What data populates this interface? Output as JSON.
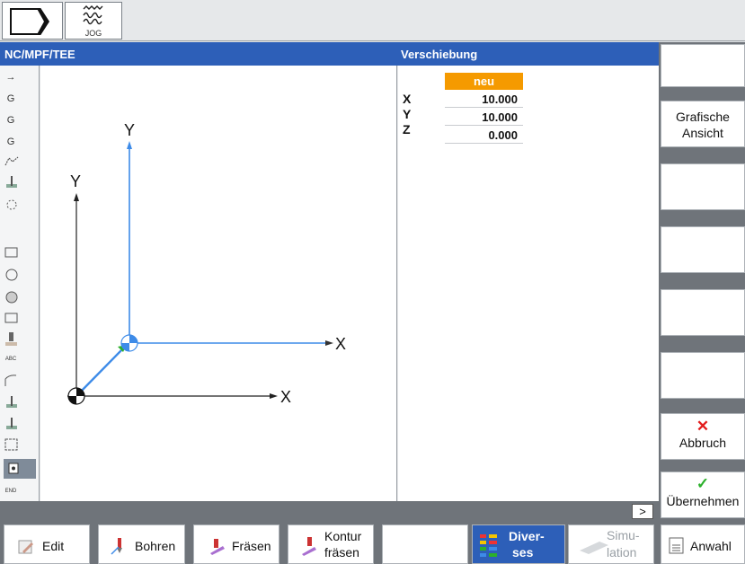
{
  "header": {
    "mode_icon": "block-arrow-icon",
    "jog_label": "JOG"
  },
  "titlebar": {
    "program_path": "NC/MPF/TEE",
    "dialog_title": "Verschiebung"
  },
  "left_strip": {
    "items": [
      "→",
      "G",
      "G",
      "G",
      "ABC",
      "END"
    ]
  },
  "graphic": {
    "axis_labels": {
      "y_upper": "Y",
      "x_upper": "X",
      "y_lower": "Y",
      "x_lower": "X"
    }
  },
  "params": {
    "header": "neu",
    "rows": [
      {
        "label": "X",
        "value": "10.000"
      },
      {
        "label": "Y",
        "value": "10.000"
      },
      {
        "label": "Z",
        "value": "0.000"
      }
    ]
  },
  "softkeys": {
    "grafische": [
      "Grafische",
      "Ansicht"
    ],
    "abbruch": "Abbruch",
    "uebernehmen": "Übernehmen"
  },
  "statusline": {
    "more": ">"
  },
  "bottom": {
    "edit": "Edit",
    "bohren": "Bohren",
    "fraesen": "Fräsen",
    "kontur": [
      "Kontur",
      "fräsen"
    ],
    "divers": [
      "Diver-",
      "ses"
    ],
    "simulation": [
      "Simu-",
      "lation"
    ],
    "anwahl": "Anwahl"
  },
  "colors": {
    "title_blue": "#2d5fb8",
    "highlight_orange": "#f59a00",
    "axis_blue": "#3d8be8",
    "cancel_red": "#e31b1b",
    "ok_green": "#2bb02b"
  }
}
